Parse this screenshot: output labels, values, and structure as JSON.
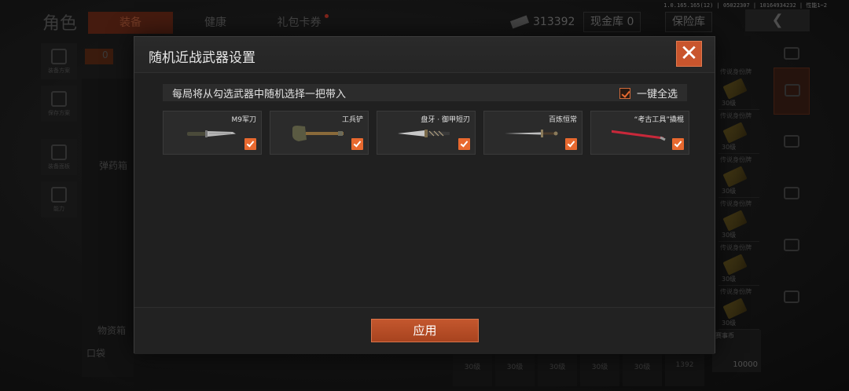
{
  "background": {
    "title": "角色",
    "tabs": [
      {
        "label": "装备"
      },
      {
        "label": "健康"
      },
      {
        "label": "礼包卡券"
      }
    ],
    "currency_value": "313392",
    "cash_storage": "现金库 0",
    "safe_storage": "保险库",
    "version": "1.0.165.165(12) | 05022307 | 10164934232 | 性能1~2",
    "left_sidebar": [
      {
        "label": "装备方案"
      },
      {
        "label": "保存方案"
      },
      {
        "label": "装备面板"
      },
      {
        "label": "能力"
      }
    ],
    "left_counter": "0",
    "ammo_label": "弹药箱",
    "supplies_label": "物资箱",
    "pocket_label": "口袋",
    "right_items": [
      {
        "label": "传说身份牌",
        "count": "30级"
      },
      {
        "label": "传说身份牌",
        "count": "30级"
      },
      {
        "label": "传说身份牌",
        "count": "30级"
      },
      {
        "label": "传说身份牌",
        "count": "30级"
      },
      {
        "label": "传说身份牌",
        "count": "30级"
      },
      {
        "label": "传说身份牌",
        "count": "30级"
      }
    ],
    "bottom_items": [
      {
        "label": "30级"
      },
      {
        "label": "30级"
      },
      {
        "label": "30级"
      },
      {
        "label": "30级"
      },
      {
        "label": "30级"
      },
      {
        "label": "1392"
      }
    ],
    "money_label": "赛事币",
    "money_value": "10000"
  },
  "modal": {
    "title": "随机近战武器设置",
    "instruction": "每局将从勾选武器中随机选择一把带入",
    "select_all_label": "一键全选",
    "select_all_checked": true,
    "apply_label": "应用",
    "weapons": [
      {
        "name": "M9军刀",
        "icon": "knife-icon",
        "checked": true
      },
      {
        "name": "工兵铲",
        "icon": "shovel-icon",
        "checked": true
      },
      {
        "name": "盘牙 · 御甲短刃",
        "icon": "dagger-icon",
        "checked": true
      },
      {
        "name": "百炼恒常",
        "icon": "sword-icon",
        "checked": true
      },
      {
        "name": "“考古工具”撬棍",
        "icon": "crowbar-icon",
        "checked": true
      }
    ],
    "accent_color": "#e8692f"
  }
}
